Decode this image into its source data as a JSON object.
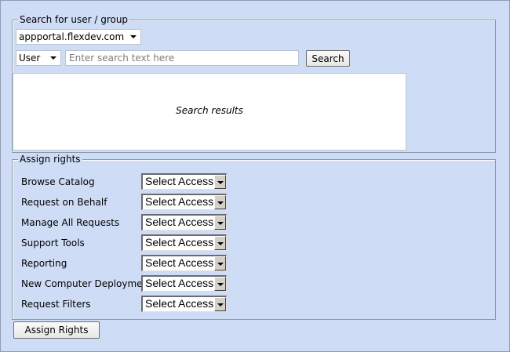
{
  "search_group": {
    "legend": "Search for user / group",
    "domain_value": "appportal.flexdev.com",
    "type_value": "User",
    "search_placeholder": "Enter search text here",
    "search_value": "",
    "search_button": "Search",
    "results_label": "Search results"
  },
  "assign_group": {
    "legend": "Assign rights",
    "rights": [
      {
        "label": "Browse Catalog",
        "access": "Select Access"
      },
      {
        "label": "Request on Behalf",
        "access": "Select Access"
      },
      {
        "label": "Manage All Requests",
        "access": "Select Access"
      },
      {
        "label": "Support Tools",
        "access": "Select Access"
      },
      {
        "label": "Reporting",
        "access": "Select Access"
      },
      {
        "label": "New Computer Deployment",
        "access": "Select Access"
      },
      {
        "label": "Request Filters",
        "access": "Select Access"
      }
    ]
  },
  "assign_button": "Assign Rights"
}
